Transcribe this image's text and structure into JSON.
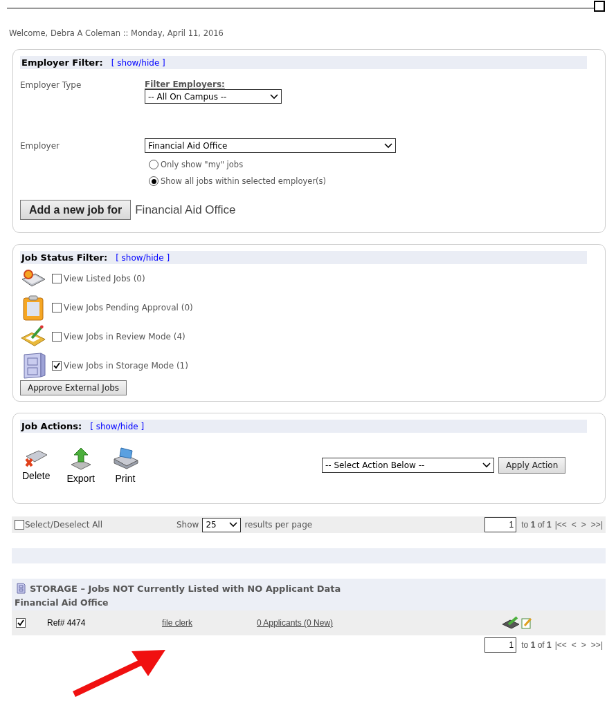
{
  "welcome": "Welcome, Debra A Coleman :: Monday, April 11, 2016",
  "employer_filter": {
    "title": "Employer Filter:",
    "toggle": "[ show/hide ]",
    "type_label": "Employer Type",
    "filter_label": "Filter Employers:",
    "type_value": "-- All On Campus --",
    "employer_label": "Employer",
    "employer_value": "Financial Aid Office",
    "radios": [
      {
        "label": "Only show \"my\" jobs",
        "selected": false
      },
      {
        "label": "Show all jobs within selected employer(s)",
        "selected": true
      }
    ],
    "add_button": "Add a new job for",
    "add_target": "Financial Aid Office"
  },
  "job_status_filter": {
    "title": "Job Status Filter:",
    "toggle": "[ show/hide ]",
    "items": [
      {
        "kind": "listed",
        "label": "View Listed Jobs (0)",
        "checked": false
      },
      {
        "kind": "pending",
        "label": "View Jobs Pending Approval (0)",
        "checked": false
      },
      {
        "kind": "review",
        "label": "View Jobs in Review Mode (4)",
        "checked": false
      },
      {
        "kind": "storage",
        "label": "View Jobs in Storage Mode (1)",
        "checked": true
      }
    ],
    "approve_button": "Approve External Jobs"
  },
  "job_actions": {
    "title": "Job Actions:",
    "toggle": "[ show/hide ]",
    "actions": [
      {
        "kind": "delete",
        "label": "Delete"
      },
      {
        "kind": "export",
        "label": "Export"
      },
      {
        "kind": "print",
        "label": "Print"
      }
    ],
    "select_value": "-- Select Action Below --",
    "apply_button": "Apply Action"
  },
  "list_bar": {
    "select_all_label": "Select/Deselect All",
    "select_all_checked": false,
    "show_label": "Show",
    "per_page_value": "25",
    "per_page_suffix": "results per page",
    "pager": {
      "page": "1",
      "summary": "to **1** of **1**",
      "nav": [
        "|<<",
        "<",
        ">",
        ">>|"
      ]
    }
  },
  "storage": {
    "title": "STORAGE – Jobs NOT Currently Listed with NO Applicant Data",
    "employer": "Financial Aid Office",
    "rows": [
      {
        "checked": true,
        "ref": "Ref# 4474",
        "title": "file clerk",
        "applicants": "0 Applicants (0 New)"
      }
    ]
  },
  "bottom_pager": {
    "page": "1",
    "summary": "to **1** of **1**",
    "nav": [
      "|<<",
      "<",
      ">",
      ">>|"
    ]
  }
}
